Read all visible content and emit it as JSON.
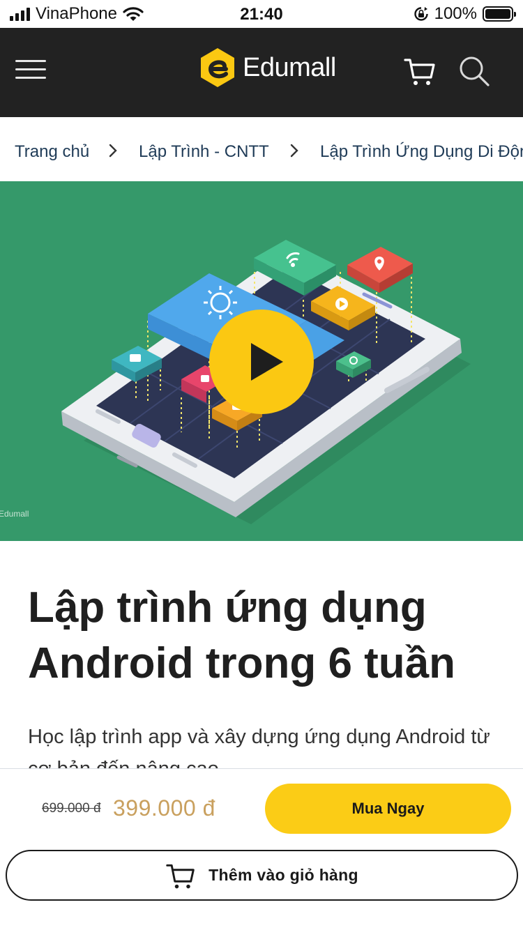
{
  "status_bar": {
    "carrier": "VinaPhone",
    "time": "21:40",
    "battery_percent": "100%",
    "battery_level": 1.0,
    "signal_bars": 4
  },
  "header": {
    "logo_text": "Edumall",
    "brand_color": "#fbc812",
    "icons": [
      "menu-icon",
      "cart-icon",
      "search-icon"
    ]
  },
  "breadcrumb": {
    "items": [
      "Trang chủ",
      "Lập Trình - CNTT",
      "Lập Trình Ứng Dụng Di Động"
    ]
  },
  "hero": {
    "background_color": "#35996a",
    "watermark": "Edumall",
    "play_icon": "play-icon"
  },
  "course": {
    "title": "Lập trình ứng dụng Android trong 6 tuần",
    "description": "Học lập trình app và xây dựng ứng dụng Android từ cơ bản đến nâng cao"
  },
  "purchase": {
    "old_price": "699.000 đ",
    "new_price": "399.000 đ",
    "buy_now_label": "Mua Ngay",
    "add_to_cart_label": "Thêm vào giỏ hàng",
    "accent_color": "#fbcc16",
    "price_color": "#c9a05e"
  }
}
